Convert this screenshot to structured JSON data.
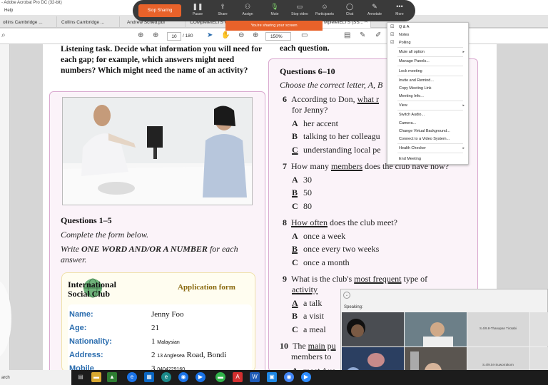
{
  "window": {
    "title": "- Adobe Acrobat Pro DC (32-bit)",
    "menu_help": "Help"
  },
  "tabs": [
    {
      "label": "ollins Cambridge ..."
    },
    {
      "label": "Collins Cambridge ..."
    },
    {
      "label": "Andrew Sched.pdf"
    },
    {
      "label": "COMpleteIELTS C..."
    },
    {
      "label": "MpleteIELTS (SS..."
    }
  ],
  "toolbar": {
    "page_current": "10",
    "page_sep": "/",
    "page_total": "180",
    "zoom": "150%"
  },
  "zoom_meeting": {
    "stop_share": "Stop Sharing",
    "sharing_banner": "You're sharing your screen",
    "buttons": [
      {
        "label": "Pause",
        "icon": "pause-icon"
      },
      {
        "label": "Share",
        "icon": "share-icon"
      },
      {
        "label": "Assign",
        "icon": "assign-icon"
      },
      {
        "label": "Mute",
        "icon": "microphone-icon"
      },
      {
        "label": "Stop video",
        "icon": "video-icon"
      },
      {
        "label": "Participants",
        "icon": "participants-icon"
      },
      {
        "label": "Chat",
        "icon": "chat-icon"
      },
      {
        "label": "Annotate",
        "icon": "annotate-icon"
      },
      {
        "label": "More",
        "icon": "more-icon"
      }
    ],
    "more_menu": [
      {
        "label": "Q & A",
        "check": true
      },
      {
        "label": "Notes",
        "check": true
      },
      {
        "label": "Polling",
        "check": true
      },
      {
        "label": "Mute all option",
        "arrow": true
      },
      {
        "label": "Manage Panels..."
      },
      {
        "label": "Lock meeting"
      },
      {
        "label": "Invite and Remind..."
      },
      {
        "label": "Copy Meeting Link"
      },
      {
        "label": "Meeting Info..."
      },
      {
        "label": "View",
        "arrow": true
      },
      {
        "label": "Switch Audio..."
      },
      {
        "label": "Camera..."
      },
      {
        "label": "Change Virtual Background..."
      },
      {
        "label": "Connect to a Video System..."
      },
      {
        "label": "Health Checker",
        "arrow": true
      },
      {
        "label": "End Meeting"
      }
    ],
    "video_panel": {
      "speaking_label": "Speaking:",
      "participants": [
        {
          "name": "S.4/9.8-Thanapan Tirotabi"
        },
        {
          "name": "S.4/9.04-Suworrakorn"
        }
      ]
    }
  },
  "document": {
    "intro_left": "Listening task. Decide what information you will need for each gap; for example, which answers might need numbers? Which might need the name of an activity?",
    "intro_right": "each question.",
    "left": {
      "heading": "Questions 1–5",
      "instruction": "Complete the form below.",
      "write_prefix": "Write ",
      "write_bold": "ONE WORD AND/OR A NUMBER",
      "write_suffix": " for each answer.",
      "form": {
        "club_line1": "International",
        "club_line2": "Social Club",
        "title": "Application form",
        "rows": [
          {
            "label": "Name:",
            "value": "Jenny Foo",
            "hand": ""
          },
          {
            "label": "Age:",
            "value": "21",
            "hand": ""
          },
          {
            "label": "Nationality:",
            "value": "1",
            "hand": "Malaysian"
          },
          {
            "label": "Address:",
            "value": "2",
            "hand": "13 Anglesea",
            "rest": " Road, Bondi"
          },
          {
            "label": "Mobile phone:",
            "value": "3",
            "hand": "0404229160"
          }
        ]
      }
    },
    "right": {
      "heading": "Questions 6–10",
      "instruction": "Choose the correct letter, A, B",
      "questions": [
        {
          "num": "6",
          "line1_pre": "According to Don, ",
          "line1_ul": "what r",
          "line2": "for Jenny?",
          "options": [
            {
              "letter": "A",
              "text": "her accent"
            },
            {
              "letter": "B",
              "text": "talking to her colleagu"
            },
            {
              "letter": "C",
              "text": "understanding local pe"
            }
          ]
        },
        {
          "num": "7",
          "line1_pre": "How many ",
          "line1_ul": "members",
          "line1_post": " does the club have now?",
          "options": [
            {
              "letter": "A",
              "text": "30"
            },
            {
              "letter": "B",
              "text": "50"
            },
            {
              "letter": "C",
              "text": "80"
            }
          ]
        },
        {
          "num": "8",
          "line1_ul": "How often",
          "line1_post": " does the club meet?",
          "options": [
            {
              "letter": "A",
              "text": "once a week"
            },
            {
              "letter": "B",
              "text": "once every two weeks"
            },
            {
              "letter": "C",
              "text": "once a month"
            }
          ]
        },
        {
          "num": "9",
          "line1_pre": "What is the club's ",
          "line1_ul": "most frequent",
          "line1_post": " type of",
          "line2_ul": "activity",
          "options": [
            {
              "letter": "A",
              "text": "a talk"
            },
            {
              "letter": "B",
              "text": "a visit"
            },
            {
              "letter": "C",
              "text": "a meal"
            }
          ]
        },
        {
          "num": "10",
          "line1_pre": "The ",
          "line1_ul": "main pu",
          "line2": "members to",
          "options": [
            {
              "letter": "A",
              "text": "meet Aus"
            }
          ]
        }
      ]
    }
  },
  "taskbar": {
    "search_text": "arch"
  }
}
